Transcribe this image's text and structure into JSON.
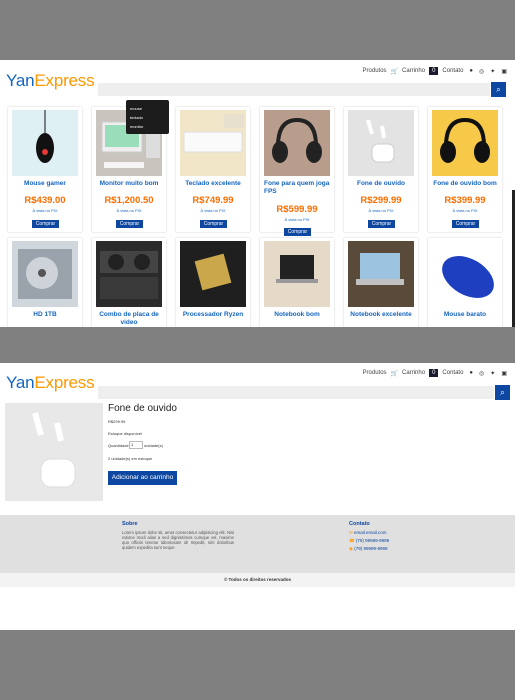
{
  "brand": {
    "part1": "Yan",
    "part2": "Express"
  },
  "nav": {
    "products": "Produtos",
    "cart": "Carrinho",
    "cart_count": "0",
    "contact": "Contato"
  },
  "dropdown": [
    "mouse",
    "teclado",
    "monitor"
  ],
  "search": {
    "button_icon": "search-icon"
  },
  "products_row1": [
    {
      "name": "Mouse gamer",
      "price": "R$439.00",
      "pix": "À vista no PIX",
      "buy": "Comprar",
      "img": "mouse"
    },
    {
      "name": "Monitor muito bom",
      "price": "R$1,200.50",
      "pix": "À vista no PIX",
      "buy": "Comprar",
      "img": "monitor"
    },
    {
      "name": "Teclado excelente",
      "price": "R$749.99",
      "pix": "À vista no PIX",
      "buy": "Comprar",
      "img": "keyboard"
    },
    {
      "name": "Fone para quem joga FPS",
      "price": "R$599.99",
      "pix": "À vista no PIX",
      "buy": "Comprar",
      "img": "headphone-dark"
    },
    {
      "name": "Fone de ouvido",
      "price": "R$299.99",
      "pix": "À vista no PIX",
      "buy": "Comprar",
      "img": "earbuds"
    },
    {
      "name": "Fone de ouvido bom",
      "price": "R$399.99",
      "pix": "À vista no PIX",
      "buy": "Comprar",
      "img": "headphone-yellow"
    }
  ],
  "products_row2": [
    {
      "name": "HD 1TB",
      "img": "hdd"
    },
    {
      "name": "Combo de placa de video",
      "img": "gpu"
    },
    {
      "name": "Processador Ryzen",
      "img": "cpu"
    },
    {
      "name": "Notebook bom",
      "img": "laptop"
    },
    {
      "name": "Notebook excelente",
      "img": "macbook"
    },
    {
      "name": "Mouse barato",
      "img": "mouse-blue"
    }
  ],
  "detail": {
    "title": "Fone de ouvido",
    "price": "R$299.99",
    "stock": "Estoque disponível",
    "qty_label": "Quantidade",
    "qty_value": "1",
    "qty_unit": "unidade(s)",
    "in_cart": "2 unidade(s) em estoque",
    "add": "Adicionar ao carrinho"
  },
  "footer": {
    "about_title": "Sobre",
    "about_text": "Lorem ipsum dolor sit, amet consectetur adipisicing elit. Nisi ratione modi alias a sed dignissimos cumque vel, maxime quo officiis tenetur laboriosam id! Impedit, sint doloribus quidem expedita sunt neque",
    "contact_title": "Contato",
    "email": "email.email.com",
    "phone": "(79) 99999-9999",
    "whatsapp": "(79) 99999-9999",
    "copyright": "© Todos os direitos reservados"
  }
}
